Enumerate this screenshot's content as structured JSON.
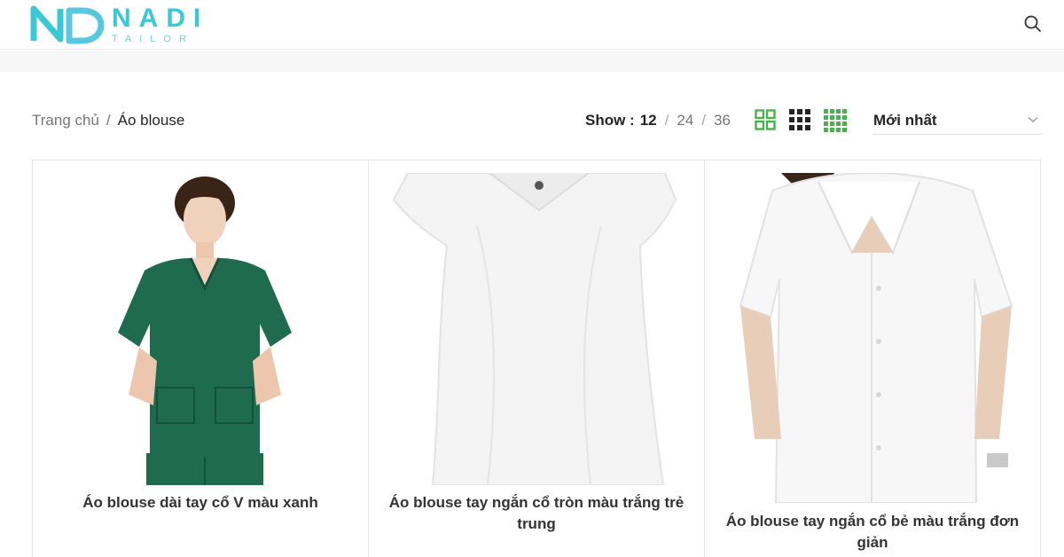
{
  "brand": {
    "name": "NADI",
    "tagline": "TAILOR",
    "primary_color": "#3cc7d6",
    "accent_color": "#4caf50"
  },
  "header": {
    "search_icon": "search-icon"
  },
  "breadcrumb": {
    "home": "Trang chủ",
    "separator": "/",
    "current": "Áo blouse"
  },
  "show": {
    "label": "Show :",
    "options": [
      "12",
      "24",
      "36"
    ],
    "active": "12"
  },
  "view_modes": [
    {
      "icon": "grid-2x2-icon",
      "active": true
    },
    {
      "icon": "grid-3x3-icon",
      "active": false
    },
    {
      "icon": "grid-4x4-icon",
      "active": false
    }
  ],
  "sort": {
    "selected": "Mới nhất"
  },
  "products": [
    {
      "title": "Áo blouse dài tay cổ V màu xanh",
      "garment_color": "#1f6b50"
    },
    {
      "title": "Áo blouse tay ngắn cổ tròn màu trắng trẻ trung",
      "garment_color": "#f4f4f4"
    },
    {
      "title": "Áo blouse tay ngắn cổ bẻ màu trắng đơn giản",
      "garment_color": "#f7f7f7"
    }
  ]
}
